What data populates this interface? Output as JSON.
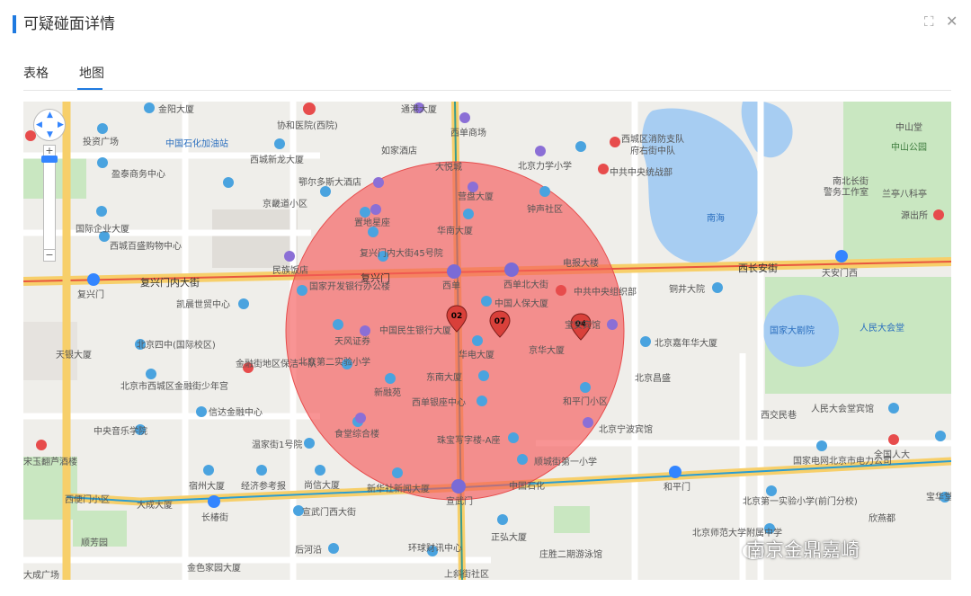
{
  "header": {
    "title": "可疑碰面详情",
    "expand_icon": "expand-icon",
    "close_icon": "close-icon"
  },
  "tabs": [
    {
      "label": "表格",
      "active": false
    },
    {
      "label": "地图",
      "active": true
    }
  ],
  "map": {
    "radius_overlay_color": "#f45b5b",
    "roads": {
      "east_west_main_west": "复兴门内大街",
      "east_west_main_mid": "复兴门内大街",
      "east_west_main_east": "西长安街",
      "subway_line_color": "#e8563f",
      "ring_road_color": "#f5c342"
    },
    "markers": [
      {
        "id": "02",
        "color": "#d9403a"
      },
      {
        "id": "07",
        "color": "#d9403a"
      },
      {
        "id": "04",
        "color": "#d9403a"
      }
    ],
    "stations": [
      "复兴门",
      "西单",
      "西单",
      "天安门西",
      "长椿街",
      "宣武门",
      "和平门"
    ],
    "labels": {
      "l1": "金阳大厦",
      "l2": "通港大厦",
      "l3": "协和医院(西院)",
      "l4": "西单商场",
      "l5": "投资广场",
      "l6": "中国石化加油站",
      "l7": "如家酒店",
      "l8": "西城区消防支队",
      "l9": "府右街中队",
      "l10": "西城新龙大厦",
      "l11": "北京力学小学",
      "l12": "中共中央统战部",
      "l13": "盈泰商务中心",
      "l14": "鄂尔多斯大酒店",
      "l15": "大悦城",
      "l16": "京畿道小区",
      "l17": "置地星座",
      "l18": "营盘大厦",
      "l19": "钟声社区",
      "l20": "南海",
      "l21": "国际企业大厦",
      "l22": "西单北大街",
      "l23": "华南大厦",
      "l24": "西城百盛购物中心",
      "l25": "复兴门内大街45号院",
      "l26": "民族饭店",
      "l27": "电报大楼",
      "l28": "天安门西",
      "l29": "国家开发银行办公楼",
      "l30": "中国人保大厦",
      "l31": "中共中央组织部",
      "l32": "铜井大院",
      "l33": "凯晨世贸中心",
      "l34": "天风证券",
      "l35": "中国民生银行大厦",
      "l36": "宝安宾馆",
      "l37": "国家大剧院",
      "l38": "人民大会堂",
      "l39": "北京四中(国际校区)",
      "l40": "北京第二实验小学",
      "l41": "华电大厦",
      "l42": "京华大厦",
      "l43": "北京嘉年华大厦",
      "l44": "金融街地区保洁一队",
      "l45": "新融苑",
      "l46": "东南大厦",
      "l47": "北京昌盛",
      "l48": "北京市西城区金融街少年宫",
      "l49": "西单银座中心",
      "l50": "和平门小区",
      "l51": "西交民巷",
      "l52": "人民大会堂宾馆",
      "l53": "信达金融中心",
      "l54": "中央音乐学院",
      "l55": "食堂综合楼",
      "l56": "珠宝写字楼-A座",
      "l57": "北京宁波宾馆",
      "l58": "全国人大",
      "l59": "温家街1号院",
      "l60": "顺城街第一小学",
      "l61": "国家电网北京市电力公司",
      "l62": "宿州大厦",
      "l63": "经济参考报",
      "l64": "尚信大厦",
      "l65": "新华社新闻大厦",
      "l66": "宣武门",
      "l67": "中国石化",
      "l68": "和平门",
      "l69": "北京第一实验小学(前门分校)",
      "l70": "大成大厦",
      "l71": "宣武门西大街",
      "l72": "宝华堂",
      "l73": "欣燕都",
      "l74": "正弘大厦",
      "l75": "长椿街",
      "l76": "环球财讯中心",
      "l77": "庄胜二期游泳馆",
      "l78": "北京师范大学附属中学",
      "l79": "后河沿",
      "l80": "上斜街社区",
      "l81": "大成广场",
      "l82": "金色家园大厦",
      "l83": "中山公园",
      "l84": "中山堂",
      "l85": "南北长街",
      "l86": "警务工作室",
      "l87": "兰亭八科亭",
      "l88": "源出所",
      "l89": "复兴门",
      "l90": "天银大厦",
      "l91": "西便门小区",
      "l92": "宋玉翻芦酒楼",
      "l93": "顺芳园",
      "l94": "西单",
      "l95": "西长安街",
      "l96": "复兴门内大街"
    }
  },
  "watermark": {
    "text": "南京金鼎嘉崎"
  }
}
